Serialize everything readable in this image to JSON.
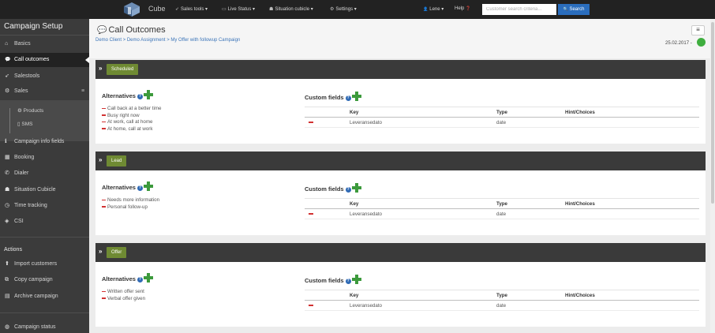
{
  "topbar": {
    "brand": "Cube",
    "nav": [
      {
        "icon": "rocket-icon",
        "glyph": "➶",
        "label": "Sales tools ▾"
      },
      {
        "icon": "monitor-icon",
        "glyph": "▭",
        "label": "Live Status ▾"
      },
      {
        "icon": "users-icon",
        "glyph": "☗",
        "label": "Situation cubicle ▾"
      },
      {
        "icon": "gear-icon",
        "glyph": "⚙",
        "label": "Settings ▾"
      }
    ],
    "user_label": "Lene ▾",
    "user_glyph": "👤",
    "help_label": "Help",
    "help_glyph": "❓",
    "search_placeholder": "Customer search criteria...",
    "search_button": "Search",
    "search_glyph": "🔍"
  },
  "sidebar": {
    "title": "Campaign Setup",
    "items": [
      {
        "icon": "home-icon",
        "glyph": "⌂",
        "label": "Basics"
      },
      {
        "icon": "comments-icon",
        "glyph": "💬",
        "label": "Call outcomes",
        "active": true
      },
      {
        "icon": "rocket-icon",
        "glyph": "➶",
        "label": "Salestools"
      },
      {
        "icon": "cogs-icon",
        "glyph": "⚙",
        "label": "Sales"
      }
    ],
    "sales_menu_glyph": "≡",
    "sub_items": [
      {
        "icon": "cogs-icon",
        "glyph": "⚙",
        "label": "Products"
      },
      {
        "icon": "mobile-icon",
        "glyph": "▯",
        "label": "SMS"
      }
    ],
    "items2": [
      {
        "icon": "info-icon",
        "glyph": "ℹ",
        "label": "Campaign info fields"
      },
      {
        "icon": "calendar-icon",
        "glyph": "▦",
        "label": "Booking"
      },
      {
        "icon": "phone-icon",
        "glyph": "✆",
        "label": "Dialer"
      },
      {
        "icon": "group-icon",
        "glyph": "☗",
        "label": "Situation Cubicle"
      },
      {
        "icon": "clock-icon",
        "glyph": "◷",
        "label": "Time tracking"
      },
      {
        "icon": "cube-icon",
        "glyph": "◈",
        "label": "CSI"
      }
    ],
    "actions_title": "Actions",
    "actions": [
      {
        "icon": "upload-icon",
        "glyph": "⬆",
        "label": "Import customers"
      },
      {
        "icon": "copy-icon",
        "glyph": "⧉",
        "label": "Copy campaign"
      },
      {
        "icon": "archive-icon",
        "glyph": "▤",
        "label": "Archive campaign"
      }
    ],
    "campaign_status": {
      "icon": "dashboard-icon",
      "glyph": "◍",
      "label": "Campaign status"
    }
  },
  "header": {
    "title": "Call Outcomes",
    "title_glyph": "💬",
    "breadcrumb": "Demo Client > Demo Assignment > My Offer with followup Campaign",
    "date": "25.02.2017 -",
    "menu_glyph": "≡"
  },
  "panels": [
    {
      "badge": "Scheduled",
      "alternatives_title": "Alternatives",
      "alternatives": [
        "Call back at a better time",
        "Busy right now",
        "At work, call at home",
        "At home, call at work"
      ],
      "custom_title": "Custom fields",
      "columns": [
        "",
        "Key",
        "Type",
        "Hint/Choices"
      ],
      "rows": [
        {
          "key": "Leveransedato",
          "type": "date",
          "hint": ""
        }
      ]
    },
    {
      "badge": "Lead",
      "alternatives_title": "Alternatives",
      "alternatives": [
        "Needs more information",
        "Personal follow-up"
      ],
      "custom_title": "Custom fields",
      "columns": [
        "",
        "Key",
        "Type",
        "Hint/Choices"
      ],
      "rows": [
        {
          "key": "Leveransedato",
          "type": "date",
          "hint": ""
        }
      ]
    },
    {
      "badge": "Offer",
      "alternatives_title": "Alternatives",
      "alternatives": [
        "Written offer sent",
        "Verbal offer given"
      ],
      "custom_title": "Custom fields",
      "columns": [
        "",
        "Key",
        "Type",
        "Hint/Choices"
      ],
      "rows": [
        {
          "key": "Leveransedato",
          "type": "date",
          "hint": ""
        }
      ]
    }
  ],
  "colors": {
    "accent": "#2a6dbd",
    "badge": "#6f8a33",
    "add": "#3c9a3c",
    "remove": "#d23232",
    "status": "#3fae3f"
  }
}
